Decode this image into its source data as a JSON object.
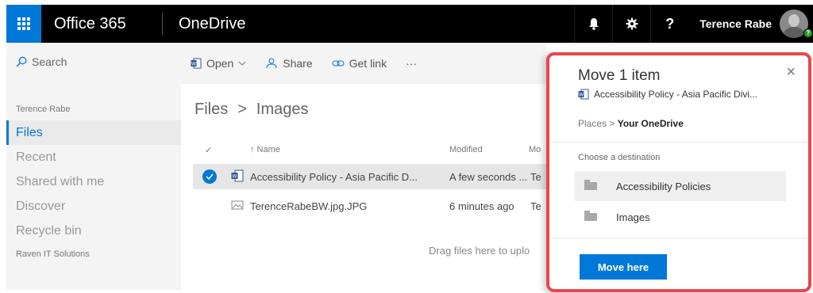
{
  "topbar": {
    "brand": "Office 365",
    "app": "OneDrive",
    "help_glyph": "?",
    "user_name": "Terence Rabe",
    "avatar_badge": "?",
    "icons": [
      "app-launcher-icon",
      "bell-icon",
      "gear-icon",
      "help-icon"
    ]
  },
  "leftnav": {
    "search_placeholder": "Search",
    "owner": "Terence Rabe",
    "items": [
      {
        "label": "Files",
        "active": true
      },
      {
        "label": "Recent"
      },
      {
        "label": "Shared with me"
      },
      {
        "label": "Discover"
      },
      {
        "label": "Recycle bin"
      }
    ],
    "org": "Raven IT Solutions"
  },
  "commands": {
    "open": "Open",
    "share": "Share",
    "get_link": "Get link",
    "more": "···"
  },
  "breadcrumb": {
    "root": "Files",
    "separator": ">",
    "current": "Images"
  },
  "columns": {
    "check": "✓",
    "name": "↑ Name",
    "modified": "Modified",
    "modified_by": "Mo"
  },
  "files": [
    {
      "name": "Accessibility Policy - Asia Pacific D...",
      "modified": "A few seconds ...",
      "by": "Te",
      "type": "word",
      "selected": true
    },
    {
      "name": "TerenceRabeBW.jpg.JPG",
      "modified": "6 minutes ago",
      "by": "Te",
      "type": "image",
      "selected": false
    }
  ],
  "drop_hint": "Drag files here to uplo",
  "panel": {
    "title": "Move 1 item",
    "close": "×",
    "file_name": "Accessibility Policy - Asia Pacific Divi...",
    "crumb_places": "Places",
    "crumb_separator": ">",
    "crumb_current": "Your OneDrive",
    "section_label": "Choose a destination",
    "folders": [
      {
        "name": "Accessibility Policies",
        "highlighted": true
      },
      {
        "name": "Images",
        "highlighted": false
      }
    ],
    "button": "Move here",
    "border_color": "#e8474c"
  },
  "colors": {
    "accent": "#0078d7",
    "topbar": "#000000",
    "nav_bg": "#f4f4f4"
  }
}
